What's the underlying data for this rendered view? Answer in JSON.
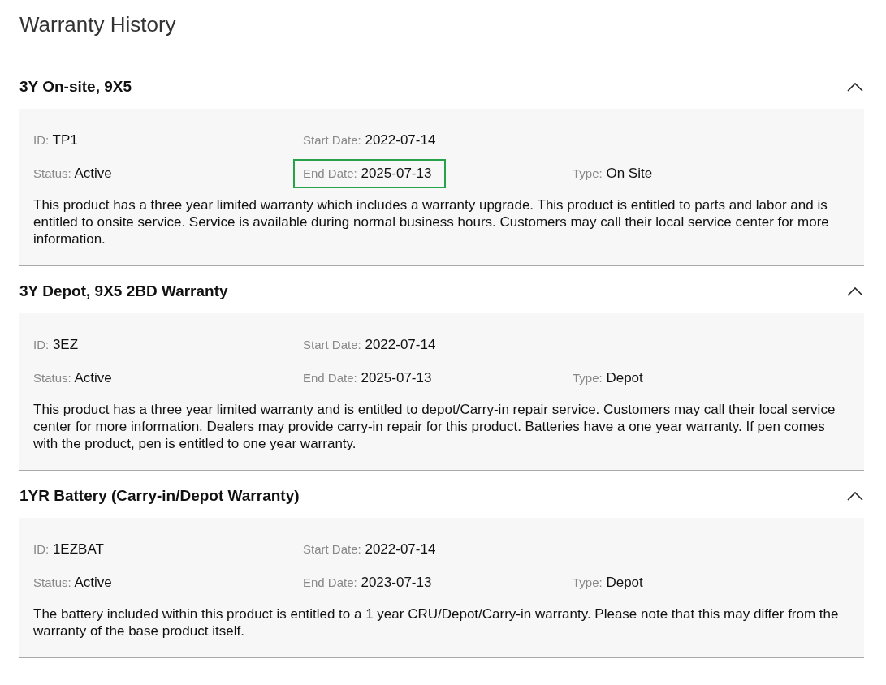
{
  "title": "Warranty History",
  "warranties": [
    {
      "name": "3Y On-site, 9X5",
      "expanded": true,
      "rows": [
        [
          {
            "label": "ID:",
            "value": "TP1",
            "highlighted": false
          },
          {
            "label": "Start Date:",
            "value": "2022-07-14",
            "highlighted": false
          }
        ],
        [
          {
            "label": "Status:",
            "value": "Active",
            "highlighted": false
          },
          {
            "label": "End Date:",
            "value": "2025-07-13",
            "highlighted": true
          },
          {
            "label": "Type:",
            "value": "On Site",
            "highlighted": false
          }
        ]
      ],
      "description": "This product has a three year limited warranty which includes a warranty upgrade. This product is entitled to parts and labor and is entitled to onsite service. Service is available during normal business hours. Customers may call their local service center for more information."
    },
    {
      "name": "3Y Depot, 9X5 2BD Warranty",
      "expanded": true,
      "rows": [
        [
          {
            "label": "ID:",
            "value": "3EZ",
            "highlighted": false
          },
          {
            "label": "Start Date:",
            "value": "2022-07-14",
            "highlighted": false
          }
        ],
        [
          {
            "label": "Status:",
            "value": "Active",
            "highlighted": false
          },
          {
            "label": "End Date:",
            "value": "2025-07-13",
            "highlighted": false
          },
          {
            "label": "Type:",
            "value": "Depot",
            "highlighted": false
          }
        ]
      ],
      "description": "This product has a three year limited warranty and is entitled to depot/Carry-in repair service. Customers may call their local service center for more information. Dealers may provide carry-in repair for this product. Batteries have a one year warranty. If pen comes with the product, pen is entitled to one year warranty."
    },
    {
      "name": "1YR Battery (Carry-in/Depot Warranty)",
      "expanded": true,
      "rows": [
        [
          {
            "label": "ID:",
            "value": "1EZBAT",
            "highlighted": false
          },
          {
            "label": "Start Date:",
            "value": "2022-07-14",
            "highlighted": false
          }
        ],
        [
          {
            "label": "Status:",
            "value": "Active",
            "highlighted": false
          },
          {
            "label": "End Date:",
            "value": "2023-07-13",
            "highlighted": false
          },
          {
            "label": "Type:",
            "value": "Depot",
            "highlighted": false
          }
        ]
      ],
      "description": "The battery included within this product is entitled to a 1 year CRU/Depot/Carry-in warranty. Please note that this may differ from the warranty of the base product itself."
    }
  ]
}
